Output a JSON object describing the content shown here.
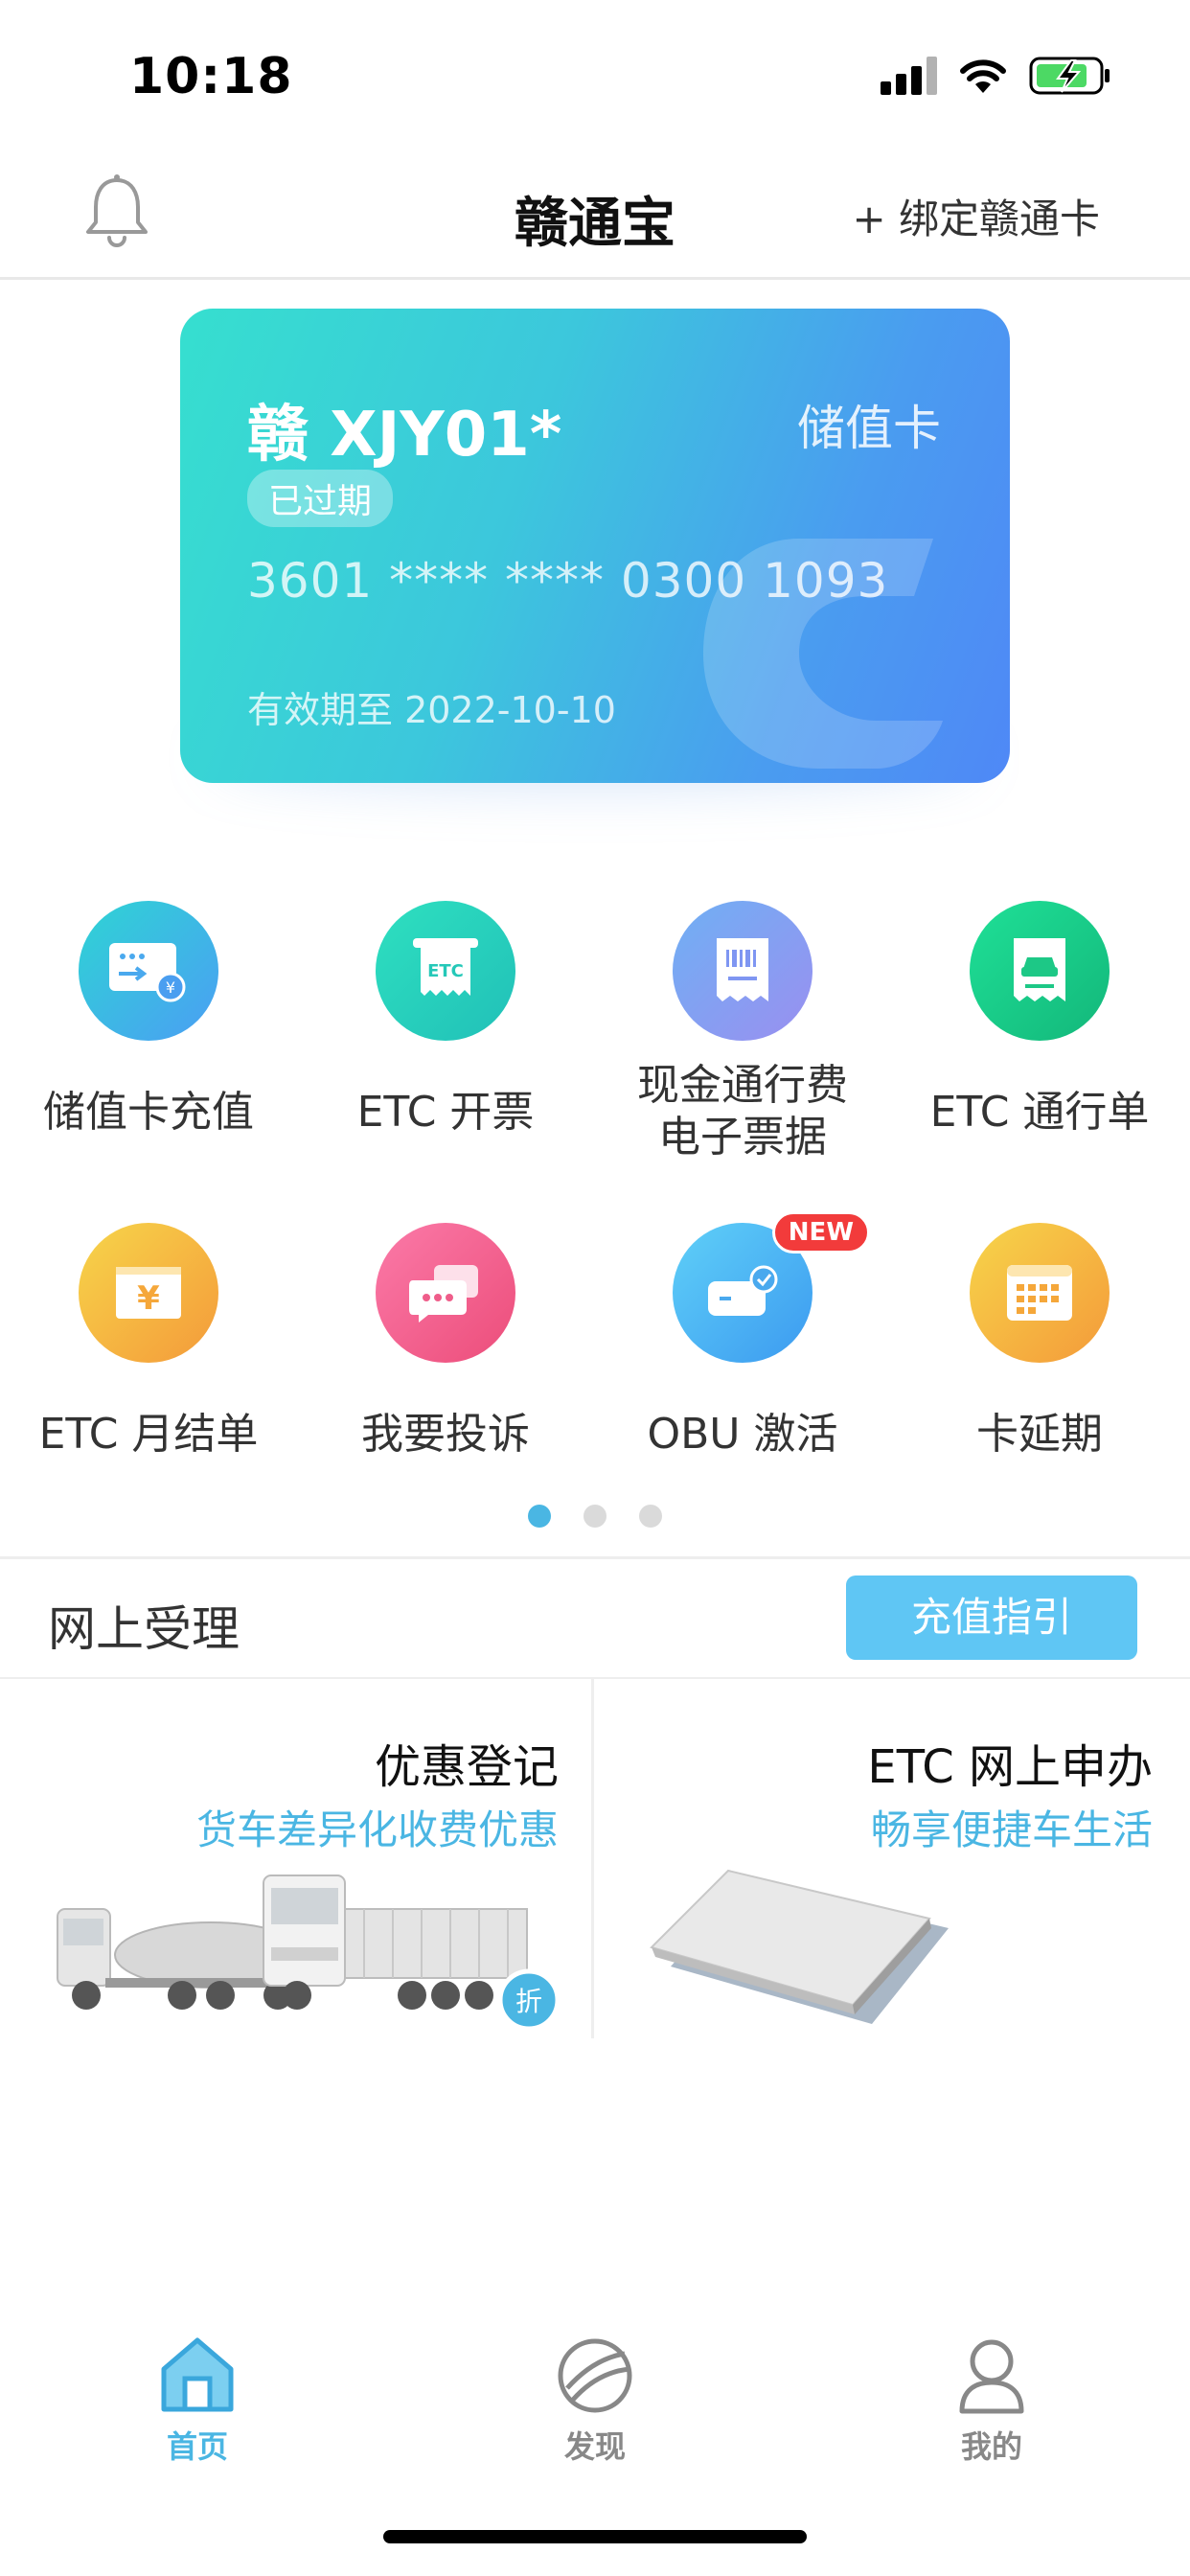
{
  "status": {
    "time": "10:18"
  },
  "header": {
    "title": "赣通宝",
    "bind_card": "+ 绑定赣通卡"
  },
  "card": {
    "plate": "赣 XJY01*",
    "type": "储值卡",
    "status": "已过期",
    "number": "3601 **** **** 0300 1093",
    "expiry": "有效期至 2022-10-10"
  },
  "functions": [
    {
      "label": "储值卡充值",
      "icon": "card-recharge-icon",
      "color": "#3fb6e8"
    },
    {
      "label": "ETC 开票",
      "icon": "etc-invoice-icon",
      "color": "#2dd3be",
      "icon_text": "ETC"
    },
    {
      "label": "现金通行费\n电子票据",
      "icon": "receipt-icon",
      "color": "#7f96f2"
    },
    {
      "label": "ETC 通行单",
      "icon": "car-ticket-icon",
      "color": "#22cf86"
    },
    {
      "label": "ETC 月结单",
      "icon": "monthly-bill-icon",
      "color": "#f5b93a",
      "icon_text": "¥"
    },
    {
      "label": "我要投诉",
      "icon": "complaint-icon",
      "color": "#f25f8f"
    },
    {
      "label": "OBU 激活",
      "icon": "obu-activate-icon",
      "color": "#45b8f0",
      "badge": "NEW"
    },
    {
      "label": "卡延期",
      "icon": "card-extend-icon",
      "color": "#f5b93a"
    }
  ],
  "pager": {
    "pages": 3,
    "active": 0
  },
  "online": {
    "title": "网上受理",
    "guide_button": "充值指引",
    "panels": [
      {
        "title": "优惠登记",
        "subtitle": "货车差异化收费优惠",
        "badge": "折"
      },
      {
        "title": "ETC 网上申办",
        "subtitle": "畅享便捷车生活"
      }
    ]
  },
  "tabbar": {
    "items": [
      {
        "label": "首页",
        "icon": "home-icon",
        "active": true
      },
      {
        "label": "发现",
        "icon": "discover-icon",
        "active": false
      },
      {
        "label": "我的",
        "icon": "profile-icon",
        "active": false
      }
    ],
    "active_color": "#4ab6e3",
    "inactive_color": "#888888"
  }
}
